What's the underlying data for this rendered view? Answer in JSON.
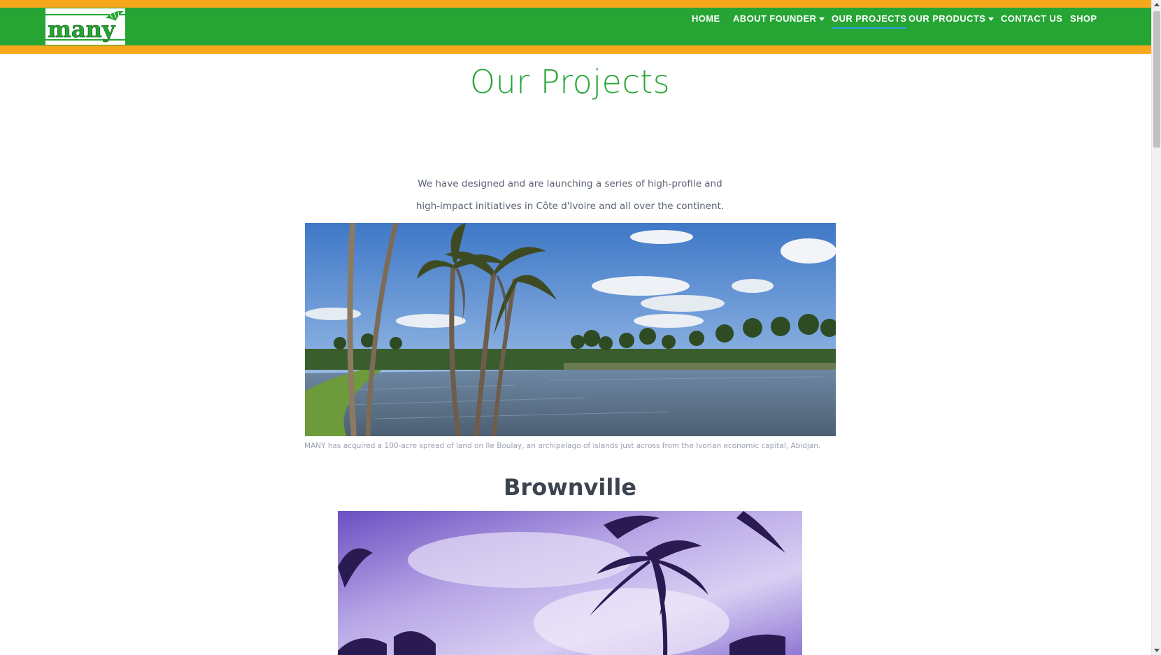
{
  "header": {
    "logo_text": "many",
    "nav": [
      {
        "label": "HOME",
        "dropdown": false,
        "active": false
      },
      {
        "label": "ABOUT FOUNDER",
        "dropdown": true,
        "active": false
      },
      {
        "label": "OUR PROJECTS",
        "dropdown": false,
        "active": true
      },
      {
        "label": "OUR PRODUCTS",
        "dropdown": true,
        "active": false
      },
      {
        "label": "CONTACT US",
        "dropdown": false,
        "active": false
      },
      {
        "label": "SHOP",
        "dropdown": false,
        "active": false
      }
    ]
  },
  "main": {
    "title": "Our Projects",
    "intro_line1": "We have designed and are launching a series of high-profile and",
    "intro_line2": "high-impact initiatives in Côte d'Ivoire and all over the continent.",
    "hero_caption": "MANY has acquired a 100-acre spread of land on Ile Boulay, an archipelago of islands just across from the Ivorian economic capital, Abidjan.",
    "section_title": "Brownville"
  },
  "colors": {
    "nav_green": "#26a534",
    "accent_orange": "#f6a81c",
    "title_green": "#27a536",
    "active_underline": "#2e9fe0"
  }
}
